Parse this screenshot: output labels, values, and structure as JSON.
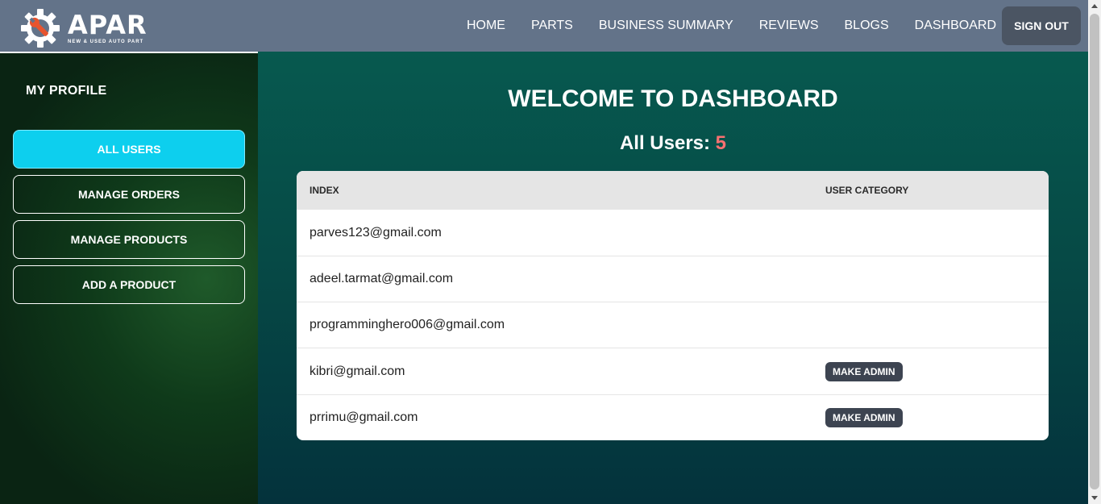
{
  "brand": {
    "title": "APAR",
    "subtitle": "NEW & USED AUTO PART",
    "accent": "#e8542e"
  },
  "nav": {
    "links": [
      "HOME",
      "PARTS",
      "BUSINESS SUMMARY",
      "REVIEWS",
      "BLOGS",
      "DASHBOARD"
    ],
    "signout": "SIGN OUT"
  },
  "sidebar": {
    "title": "MY PROFILE",
    "items": [
      {
        "label": "ALL USERS",
        "active": true
      },
      {
        "label": "MANAGE ORDERS",
        "active": false
      },
      {
        "label": "MANAGE PRODUCTS",
        "active": false
      },
      {
        "label": "ADD A PRODUCT",
        "active": false
      }
    ]
  },
  "main": {
    "heading": "WELCOME TO DASHBOARD",
    "users_label": "All Users: ",
    "users_count": "5",
    "table": {
      "headers": [
        "INDEX",
        "USER CATEGORY"
      ],
      "rows": [
        {
          "email": "parves123@gmail.com",
          "action": ""
        },
        {
          "email": "adeel.tarmat@gmail.com",
          "action": ""
        },
        {
          "email": "programminghero006@gmail.com",
          "action": ""
        },
        {
          "email": "kibri@gmail.com",
          "action": "MAKE ADMIN"
        },
        {
          "email": "prrimu@gmail.com",
          "action": "MAKE ADMIN"
        }
      ]
    }
  }
}
